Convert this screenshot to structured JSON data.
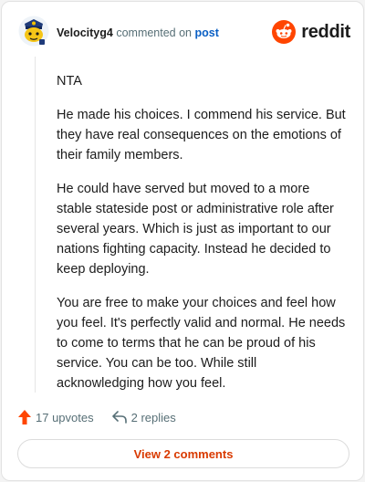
{
  "comment": {
    "author": "Velocityg4",
    "action_text": "commented on",
    "post_link": "post",
    "brand": "reddit",
    "paragraphs": [
      "NTA",
      "He made his choices. I commend his service. But they have real consequences on the emotions of their family members.",
      "He could have served but moved to a more stable stateside post or administrative role after several years. Which is just as important to our nations fighting capacity. Instead he decided to keep deploying.",
      "You are free to make your choices and feel how you feel. It's perfectly valid and normal. He needs to come to terms that he can be proud of his service. You can be too. While still acknowledging how you feel."
    ],
    "upvotes": "17 upvotes",
    "replies": "2 replies",
    "view_button": "View 2 comments"
  },
  "colors": {
    "accent": "#d93a00",
    "upvote": "#ff4500",
    "link": "#0a5fc4",
    "muted": "#576f76"
  },
  "icons": [
    "avatar-snoo-police",
    "reddit-logo-icon",
    "upvote-arrow-icon",
    "reply-icon"
  ]
}
